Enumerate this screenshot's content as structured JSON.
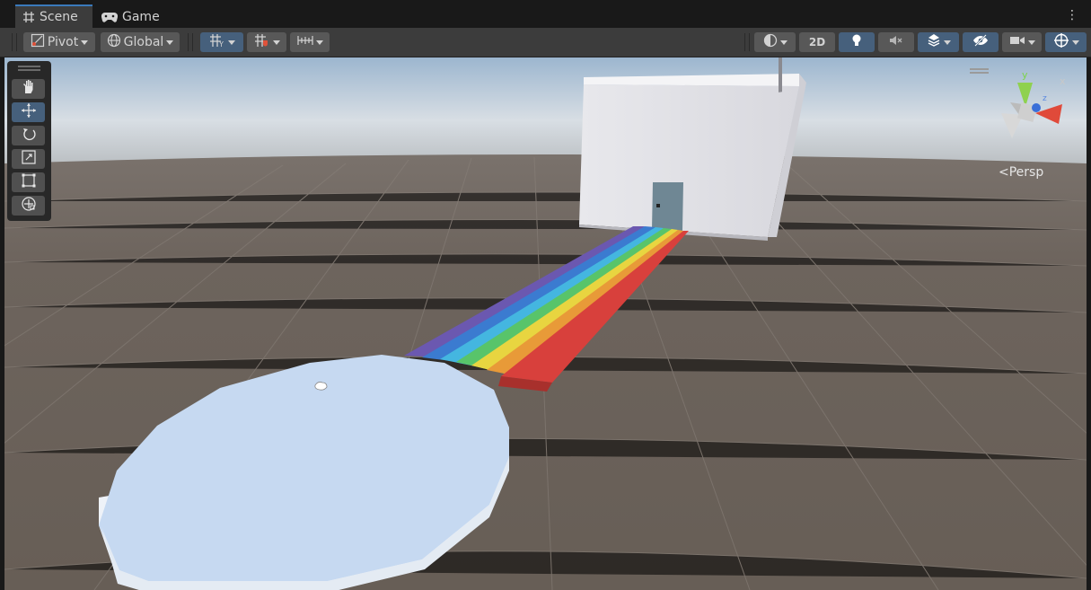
{
  "tabs": [
    {
      "label": "Scene",
      "icon": "grid-hash-icon",
      "active": true
    },
    {
      "label": "Game",
      "icon": "gamepad-icon",
      "active": false
    }
  ],
  "toolbar": {
    "pivot_label": "Pivot",
    "global_label": "Global",
    "mode_2d_label": "2D"
  },
  "tools": [
    {
      "name": "hand-tool",
      "icon": "hand-icon",
      "active": false
    },
    {
      "name": "move-tool",
      "icon": "move-arrows-icon",
      "active": true
    },
    {
      "name": "rotate-tool",
      "icon": "rotate-icon",
      "active": false
    },
    {
      "name": "scale-tool",
      "icon": "scale-icon",
      "active": false
    },
    {
      "name": "rect-tool",
      "icon": "rect-icon",
      "active": false
    },
    {
      "name": "transform-tool",
      "icon": "transform-icon",
      "active": false
    }
  ],
  "gizmo": {
    "projection_label": "Persp",
    "axis_y_label": "y",
    "axis_z_label": "z"
  },
  "colors": {
    "accent": "#3a79bb",
    "toggle_on": "#46607c",
    "ground": "#6a6058",
    "platform": "#c8daf2"
  }
}
